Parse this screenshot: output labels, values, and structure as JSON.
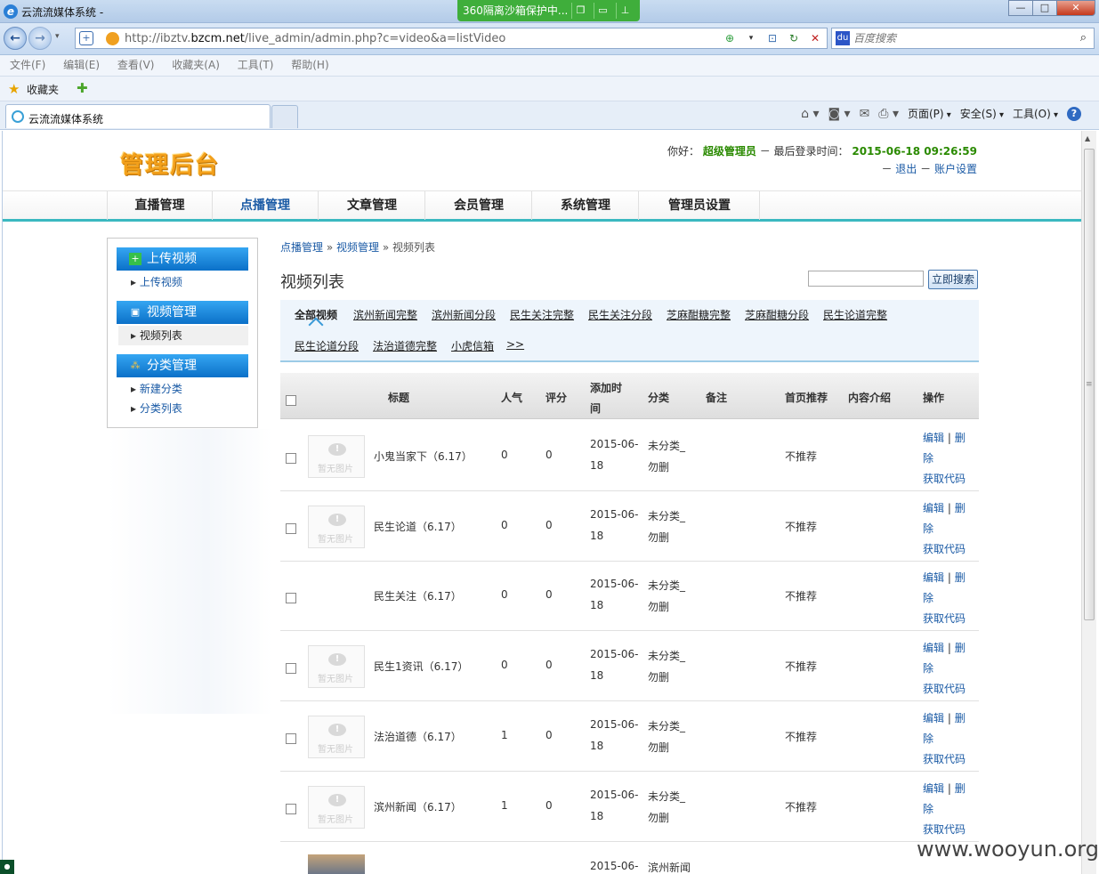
{
  "browser": {
    "window_title": "云流流媒体系统 -",
    "sandbox_label": "360隔离沙箱保护中...",
    "url_prefix": "http://ibztv.",
    "url_domain": "bzcm.net",
    "url_path": "/live_admin/admin.php?c=video&a=listVideo",
    "search_placeholder": "百度搜索",
    "menu": [
      "文件(F)",
      "编辑(E)",
      "查看(V)",
      "收藏夹(A)",
      "工具(T)",
      "帮助(H)"
    ],
    "favorites_label": "收藏夹",
    "tab_title": "云流流媒体系统",
    "commands": {
      "page": "页面(P)",
      "safety": "安全(S)",
      "tools": "工具(O)"
    }
  },
  "header": {
    "logo": "管理后台",
    "greeting": "你好：",
    "user": "超级管理员",
    "last_login_label": "－ 最后登录时间：",
    "last_login_time": "2015-06-18 09:26:59",
    "logout": "退出",
    "account": "账户设置",
    "dash": "－"
  },
  "nav": [
    {
      "label": "直播管理"
    },
    {
      "label": "点播管理"
    },
    {
      "label": "文章管理"
    },
    {
      "label": "会员管理"
    },
    {
      "label": "系统管理"
    },
    {
      "label": "管理员设置"
    }
  ],
  "sidebar": {
    "upload_head": "上传视频",
    "upload_link": "上传视频",
    "video_head": "视频管理",
    "video_list": "视频列表",
    "category_head": "分类管理",
    "new_category": "新建分类",
    "category_list": "分类列表"
  },
  "breadcrumb": {
    "a": "点播管理",
    "b": "视频管理",
    "c": "视频列表",
    "sep": "»"
  },
  "page_title": "视频列表",
  "search_button": "立即搜索",
  "filters": [
    "全部视频",
    "滨州新闻完整",
    "滨州新闻分段",
    "民生关注完整",
    "民生关注分段",
    "芝麻酣糖完整",
    "芝麻酣糖分段",
    "民生论道完整",
    "民生论道分段",
    "法治道德完整",
    "小虎信箱",
    ">>"
  ],
  "table": {
    "headers": {
      "title": "标题",
      "pop": "人气",
      "score": "评分",
      "added1": "添加时",
      "added2": "间",
      "cat": "分类",
      "note": "备注",
      "home": "首页推荐",
      "intro": "内容介绍",
      "ops": "操作"
    },
    "no_image_text": "暂无图片",
    "rows": [
      {
        "title": "小鬼当家下（6.17）",
        "pop": "0",
        "score": "0",
        "date1": "2015-06-",
        "date2": "18",
        "cat1": "未分类_",
        "cat2": "勿删",
        "home": "不推荐",
        "thumb": true
      },
      {
        "title": "民生论道（6.17）",
        "pop": "0",
        "score": "0",
        "date1": "2015-06-",
        "date2": "18",
        "cat1": "未分类_",
        "cat2": "勿删",
        "home": "不推荐",
        "thumb": true
      },
      {
        "title": "民生关注（6.17）",
        "pop": "0",
        "score": "0",
        "date1": "2015-06-",
        "date2": "18",
        "cat1": "未分类_",
        "cat2": "勿删",
        "home": "不推荐",
        "thumb": false
      },
      {
        "title": "民生1资讯（6.17）",
        "pop": "0",
        "score": "0",
        "date1": "2015-06-",
        "date2": "18",
        "cat1": "未分类_",
        "cat2": "勿删",
        "home": "不推荐",
        "thumb": true
      },
      {
        "title": "法治道德（6.17）",
        "pop": "1",
        "score": "0",
        "date1": "2015-06-",
        "date2": "18",
        "cat1": "未分类_",
        "cat2": "勿删",
        "home": "不推荐",
        "thumb": true
      },
      {
        "title": "滨州新闻（6.17）",
        "pop": "1",
        "score": "0",
        "date1": "2015-06-",
        "date2": "18",
        "cat1": "未分类_",
        "cat2": "勿删",
        "home": "不推荐",
        "thumb": true
      }
    ],
    "ops": {
      "edit": "编辑",
      "del1": "删",
      "del2": "除",
      "code": "获取代码",
      "sep": "|"
    },
    "partial_row": {
      "date1": "2015-06-",
      "cat1": "滨州新闻"
    }
  },
  "watermark": "www.wooyun.org"
}
